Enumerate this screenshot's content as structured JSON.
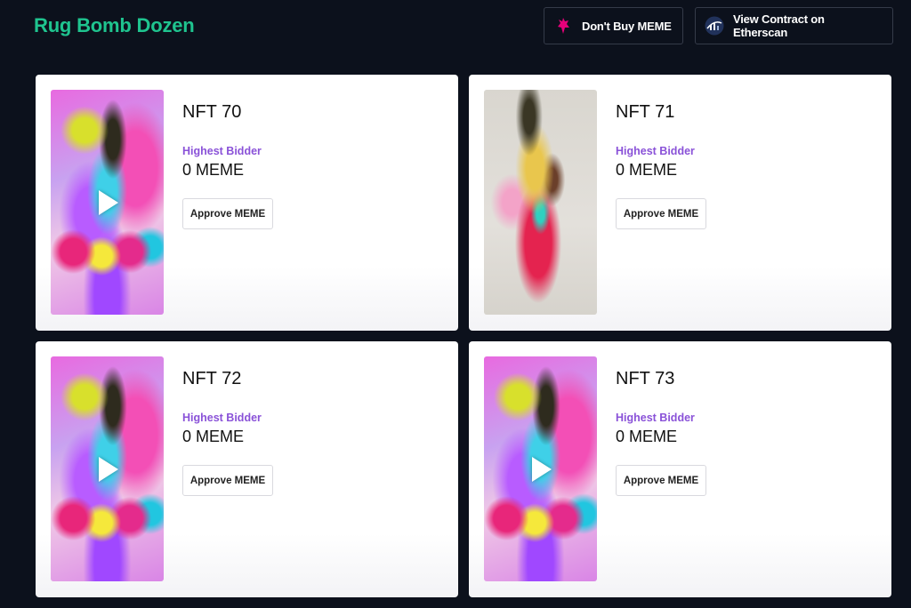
{
  "header": {
    "brand": "Rug Bomb Dozen",
    "buttons": [
      {
        "label": "Don't Buy MEME",
        "icon": "unicorn-icon",
        "icon_color": "#e6007a"
      },
      {
        "label": "View Contract on Etherscan",
        "icon": "etherscan-icon",
        "icon_color": "#21325b"
      }
    ]
  },
  "colors": {
    "background": "#0c111c",
    "brand": "#1fc48f",
    "bid_label": "#8a52d8",
    "card": "#ffffff"
  },
  "cards": [
    {
      "title": "NFT 70",
      "bid_label": "Highest Bidder",
      "bid_value": "0 MEME",
      "button": "Approve MEME",
      "media": "video",
      "art": "psychedelic-rekt-video"
    },
    {
      "title": "NFT 71",
      "bid_label": "Highest Bidder",
      "bid_value": "0 MEME",
      "button": "Approve MEME",
      "media": "image",
      "art": "rekt-figure-image"
    },
    {
      "title": "NFT 72",
      "bid_label": "Highest Bidder",
      "bid_value": "0 MEME",
      "button": "Approve MEME",
      "media": "video",
      "art": "psychedelic-rekt-video"
    },
    {
      "title": "NFT 73",
      "bid_label": "Highest Bidder",
      "bid_value": "0 MEME",
      "button": "Approve MEME",
      "media": "video",
      "art": "psychedelic-rekt-video"
    }
  ]
}
